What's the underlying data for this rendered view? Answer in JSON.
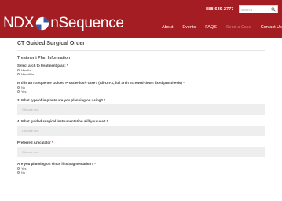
{
  "header": {
    "phone": "888-639-2777",
    "search_placeholder": "Search",
    "logo_ndx": "NDX",
    "logo_name": "nSequence",
    "nav": [
      "About",
      "Events",
      "FAQS",
      "Send a Case",
      "Contact Us"
    ],
    "brand_color": "#a31d22"
  },
  "page": {
    "title": "CT Guided Surgical Order",
    "section_title": "Treatment Plan Information"
  },
  "form": {
    "q1": {
      "label": "Select arch to treatment plan:",
      "required_mark": "*",
      "options": [
        "Maxilla",
        "Mandible"
      ]
    },
    "q2": {
      "label": "Is this an nSequence Guided Prosthetics® case? (All-On-X, full arch screwed-down fixed prosthesis)",
      "required_mark": "*",
      "options": [
        "No",
        "Yes"
      ]
    },
    "q3": {
      "label": "3. What type of implants are you planning on using?",
      "required_mark": "*",
      "placeholder": "Choose one"
    },
    "q4": {
      "label": "4. What guided surgical instrumentation will you use?",
      "required_mark": "*",
      "placeholder": "Choose one"
    },
    "q5": {
      "label": "Preferred Articulator",
      "required_mark": "*",
      "placeholder": "Choose one"
    },
    "q6": {
      "label": "Are you planning on sinus lifts/augmentation?",
      "required_mark": "*",
      "options": [
        "Yes",
        "No"
      ]
    }
  }
}
